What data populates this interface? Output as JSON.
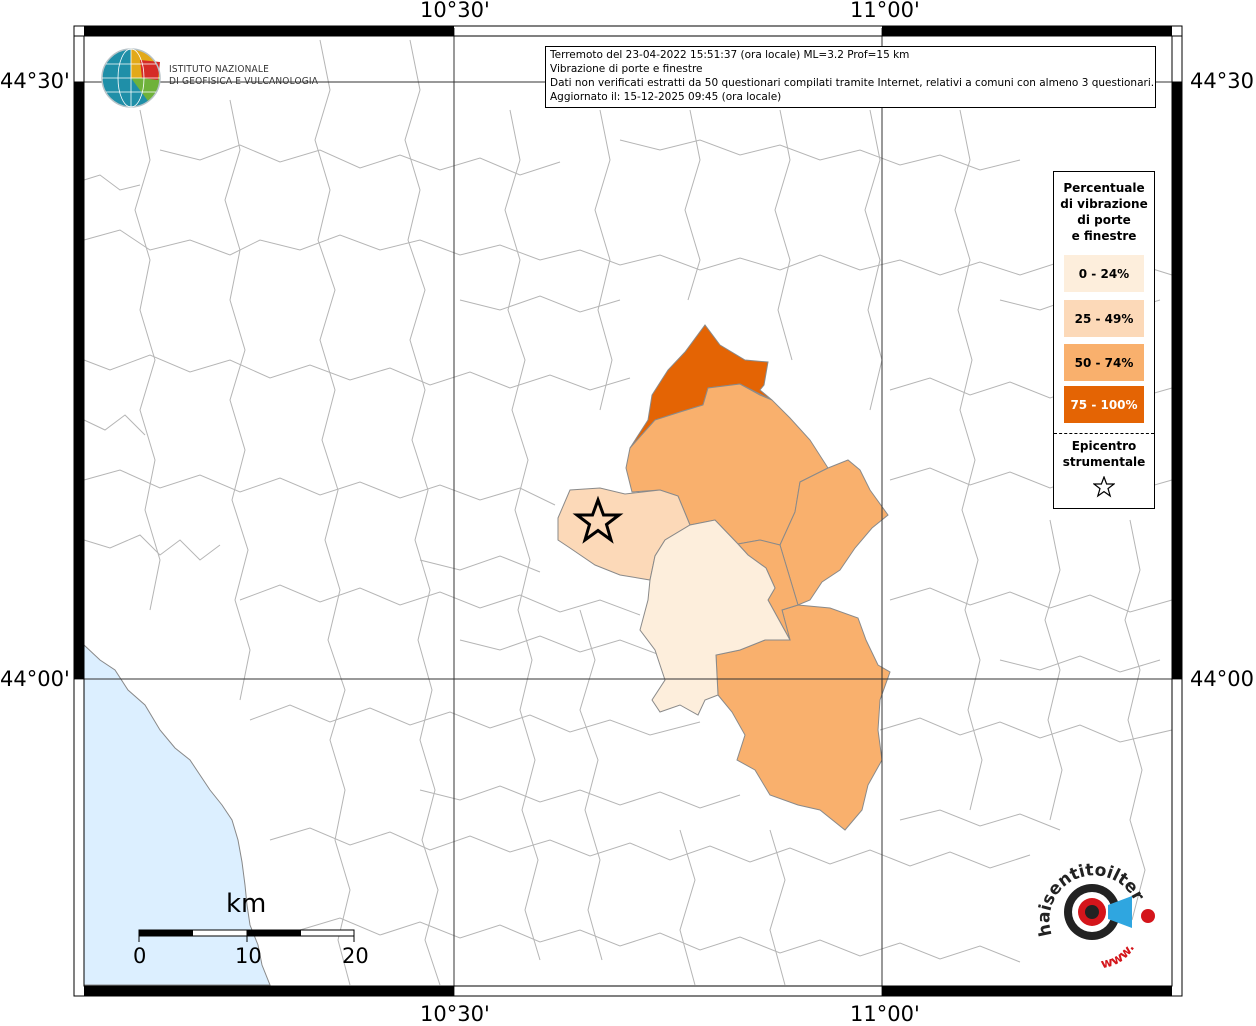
{
  "map": {
    "info_lines": [
      "Terremoto del 23-04-2022 15:51:37 (ora locale) ML=3.2 Prof=15 km",
      "Vibrazione di porte e finestre",
      "Dati non verificati estratti da 50 questionari compilati tramite Internet, relativi a comuni con almeno 3 questionari.",
      "Aggiornato il: 15-12-2025 09:45 (ora locale)"
    ],
    "axes": {
      "top_left": "10°30'",
      "top_right": "11°00'",
      "bottom_left": "10°30'",
      "bottom_right": "11°00'",
      "left_top": "44°30'",
      "left_bottom": "44°00'",
      "right_top": "44°30'",
      "right_bottom": "44°00'"
    },
    "logo": {
      "icon": "ingv-globe-logo",
      "line1": "ISTITUTO NAZIONALE",
      "line2": "DI GEOFISICA E VULCANOLOGIA"
    },
    "legend": {
      "title_lines": [
        "Percentuale",
        "di vibrazione",
        "di porte",
        "e finestre"
      ],
      "items": [
        {
          "label": "0 - 24%",
          "color": "#fdeedc",
          "text_color": "#000000"
        },
        {
          "label": "25 - 49%",
          "color": "#fcd9b8",
          "text_color": "#000000"
        },
        {
          "label": "50 - 74%",
          "color": "#f9b06d",
          "text_color": "#000000"
        },
        {
          "label": "75 - 100%",
          "color": "#e46404",
          "text_color": "#ffffff"
        }
      ],
      "epicenter_lines": [
        "Epicentro",
        "strumentale"
      ],
      "epicenter_icon": "star-icon"
    },
    "scale": {
      "title": "km",
      "labels": [
        "0",
        "10",
        "20"
      ]
    },
    "watermark": {
      "text": "haisentitoilterremoto.it",
      "prefix": "www.",
      "icon": "target-megaphone-icon"
    },
    "colors": {
      "sea": "#dcefff",
      "border": "#aaaaaa",
      "grid": "#333333"
    }
  }
}
